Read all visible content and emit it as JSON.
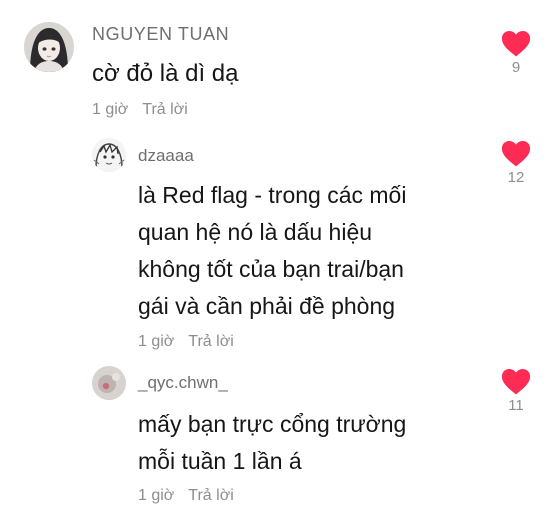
{
  "comments": [
    {
      "username": "NGUYEN TUAN",
      "text": "cờ đỏ là dì dạ",
      "time": "1 giờ",
      "reply_label": "Trả lời",
      "likes": "9"
    },
    {
      "username": "dzaaaa",
      "text_lines": [
        "là Red flag - trong các mối",
        "quan hệ nó là dấu hiệu",
        "không tốt của bạn trai/bạn",
        "gái và cần phải đề phòng"
      ],
      "time": "1 giờ",
      "reply_label": "Trả lời",
      "likes": "12"
    },
    {
      "username": "_qyc.chwn_",
      "text_lines": [
        "mấy bạn trực cổng trường",
        "mỗi tuần 1 lần á"
      ],
      "time": "1 giờ",
      "reply_label": "Trả lời",
      "likes": "11"
    }
  ],
  "colors": {
    "like_heart": "#fe2c55",
    "username": "#6f6f6f",
    "meta": "#8e8e8e",
    "text": "#161616"
  },
  "icons": {
    "like": "heart-icon"
  }
}
